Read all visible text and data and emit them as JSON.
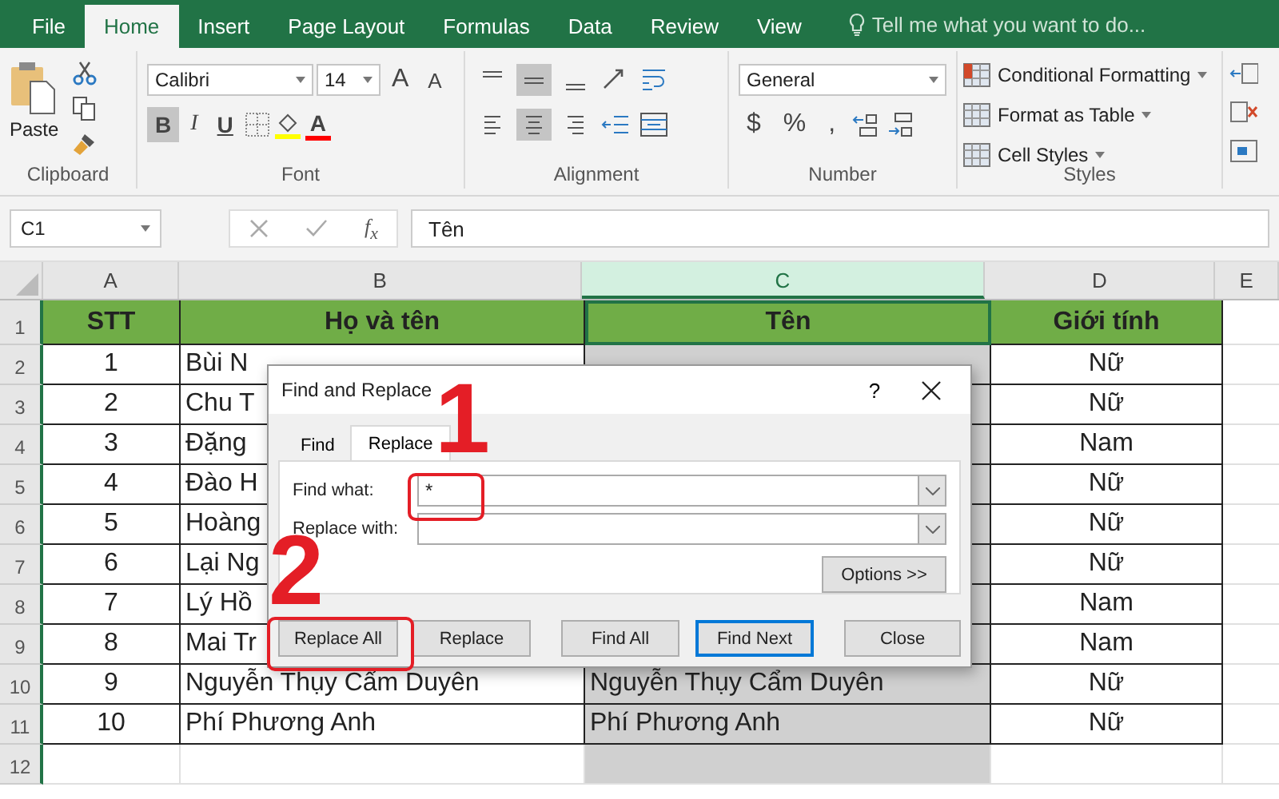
{
  "ribbon_tabs": [
    {
      "label": "File",
      "selected": false
    },
    {
      "label": "Home",
      "selected": true
    },
    {
      "label": "Insert",
      "selected": false
    },
    {
      "label": "Page Layout",
      "selected": false
    },
    {
      "label": "Formulas",
      "selected": false
    },
    {
      "label": "Data",
      "selected": false
    },
    {
      "label": "Review",
      "selected": false
    },
    {
      "label": "View",
      "selected": false
    }
  ],
  "tell_me": "Tell me what you want to do...",
  "clipboard": {
    "paste": "Paste",
    "label": "Clipboard"
  },
  "font": {
    "name": "Calibri",
    "size": "14",
    "grow": "A",
    "shrink": "A",
    "styles": [
      {
        "label": "B",
        "selected": true
      },
      {
        "label": "I",
        "selected": false
      },
      {
        "label": "U",
        "selected": false
      }
    ],
    "color_letter": "A",
    "label": "Font"
  },
  "alignment": {
    "vertical": [
      {
        "kind": "top",
        "selected": false
      },
      {
        "kind": "middle",
        "selected": true
      },
      {
        "kind": "bottom",
        "selected": false
      }
    ],
    "horizontal": [
      {
        "kind": "left",
        "selected": false
      },
      {
        "kind": "center",
        "selected": true
      },
      {
        "kind": "right",
        "selected": false
      }
    ],
    "label": "Alignment"
  },
  "number": {
    "format": "General",
    "symbols": [
      "$",
      "%",
      ","
    ],
    "label": "Number"
  },
  "styles": {
    "items": [
      "Conditional Formatting",
      "Format as Table",
      "Cell Styles"
    ],
    "label": "Styles"
  },
  "formula_bar": {
    "name_box": "C1",
    "fx": "f$_{x}$",
    "value": "Tên"
  },
  "columns": [
    {
      "label": "A",
      "selected": false
    },
    {
      "label": "B",
      "selected": false
    },
    {
      "label": "C",
      "selected": true
    },
    {
      "label": "D",
      "selected": false
    },
    {
      "label": "E",
      "selected": false
    }
  ],
  "rows": [
    {
      "num": "1",
      "kind": "header",
      "cells": [
        "STT",
        "Họ và tên",
        "Tên",
        "Giới tính"
      ]
    },
    {
      "num": "2",
      "kind": "data",
      "cells": [
        "1",
        "Bùi N",
        null,
        "Nữ"
      ]
    },
    {
      "num": "3",
      "kind": "data",
      "cells": [
        "2",
        "Chu T",
        null,
        "Nữ"
      ]
    },
    {
      "num": "4",
      "kind": "data",
      "cells": [
        "3",
        "Đặng",
        null,
        "Nam"
      ]
    },
    {
      "num": "5",
      "kind": "data",
      "cells": [
        "4",
        "Đào H",
        null,
        "Nữ"
      ]
    },
    {
      "num": "6",
      "kind": "data",
      "cells": [
        "5",
        "Hoàng",
        null,
        "Nữ"
      ]
    },
    {
      "num": "7",
      "kind": "data",
      "cells": [
        "6",
        "Lại Ng",
        null,
        "Nữ"
      ]
    },
    {
      "num": "8",
      "kind": "data",
      "cells": [
        "7",
        "Lý Hồ",
        null,
        "Nam"
      ]
    },
    {
      "num": "9",
      "kind": "data",
      "cells": [
        "8",
        "Mai Tr",
        null,
        "Nam"
      ]
    },
    {
      "num": "10",
      "kind": "data",
      "cells": [
        "9",
        "Nguyễn Thụy Cẩm Duyên",
        "Nguyễn Thụy Cẩm Duyên",
        "Nữ"
      ]
    },
    {
      "num": "11",
      "kind": "data",
      "cells": [
        "10",
        "Phí Phương Anh",
        "Phí Phương Anh",
        "Nữ"
      ]
    },
    {
      "num": "12",
      "kind": "empty",
      "cells": [
        null,
        null,
        null,
        null
      ]
    }
  ],
  "dialog": {
    "title": "Find and Replace",
    "help": "?",
    "tabs": [
      {
        "label": "Find",
        "selected": false
      },
      {
        "label": "Replace",
        "selected": true
      }
    ],
    "fields": [
      {
        "label": "Find what:",
        "value": "*"
      },
      {
        "label": "Replace with:"
      }
    ],
    "options": "Options >>",
    "buttons": [
      {
        "label": "Replace All",
        "default": false
      },
      {
        "label": "Replace",
        "default": false
      },
      {
        "label": "Find All",
        "default": false
      },
      {
        "label": "Find Next",
        "default": true
      },
      {
        "label": "Close",
        "default": false
      }
    ]
  },
  "annotations": [
    {
      "label": "1"
    },
    {
      "label": "2"
    }
  ]
}
